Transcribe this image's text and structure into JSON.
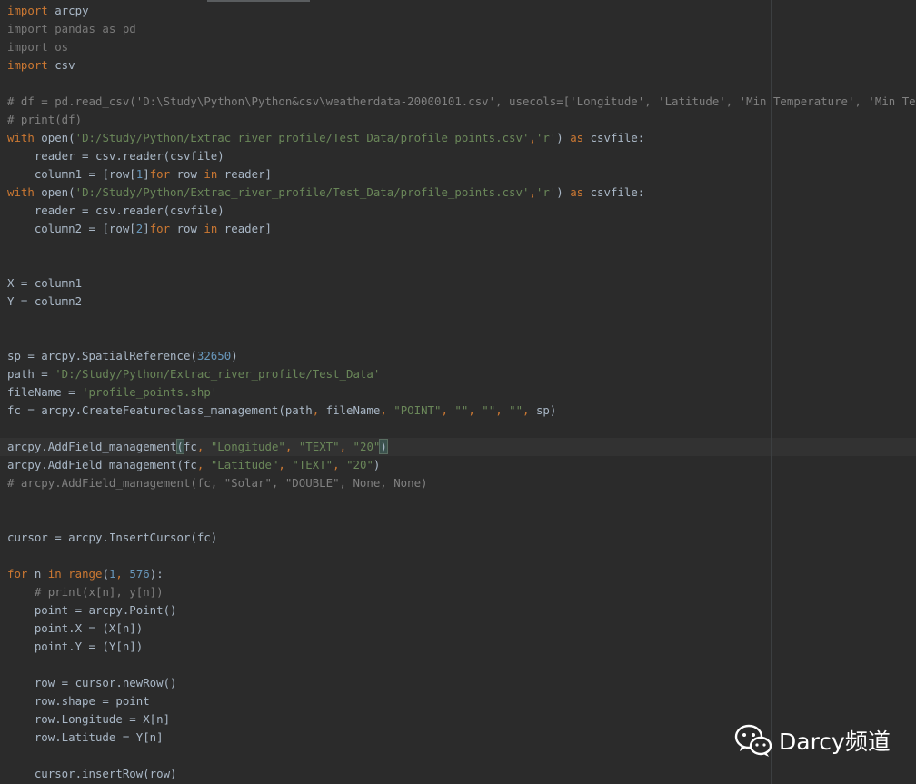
{
  "editor": {
    "lines": [
      [
        {
          "t": "import",
          "c": "kw"
        },
        {
          "t": " arcpy"
        }
      ],
      [
        {
          "t": "import pandas as pd",
          "c": "inactive"
        }
      ],
      [
        {
          "t": "import os",
          "c": "inactive"
        }
      ],
      [
        {
          "t": "import",
          "c": "kw"
        },
        {
          "t": " csv"
        }
      ],
      [],
      [
        {
          "t": "# df = pd.read_csv('D:\\Study\\Python\\Python&csv\\weatherdata-20000101.csv', usecols=['Longitude', 'Latitude', 'Min Temperature', 'Min Temperature']",
          "c": "cmt"
        }
      ],
      [
        {
          "t": "# print(df)",
          "c": "cmt"
        }
      ],
      [
        {
          "t": "with",
          "c": "kw"
        },
        {
          "t": " open("
        },
        {
          "t": "'D:/Study/Python/Extrac_river_profile/Test_Data/profile_points.csv'",
          "c": "str"
        },
        {
          "t": ",",
          "c": "kw"
        },
        {
          "t": "'r'",
          "c": "str"
        },
        {
          "t": ") "
        },
        {
          "t": "as",
          "c": "kw"
        },
        {
          "t": " csvfile:"
        }
      ],
      [
        {
          "t": "    reader = csv.reader(csvfile)"
        }
      ],
      [
        {
          "t": "    column1 = [row["
        },
        {
          "t": "1",
          "c": "num"
        },
        {
          "t": "]"
        },
        {
          "t": "for",
          "c": "kw"
        },
        {
          "t": " row "
        },
        {
          "t": "in",
          "c": "kw"
        },
        {
          "t": " reader]"
        }
      ],
      [
        {
          "t": "with",
          "c": "kw"
        },
        {
          "t": " open("
        },
        {
          "t": "'D:/Study/Python/Extrac_river_profile/Test_Data/profile_points.csv'",
          "c": "str"
        },
        {
          "t": ",",
          "c": "kw"
        },
        {
          "t": "'r'",
          "c": "str"
        },
        {
          "t": ") "
        },
        {
          "t": "as",
          "c": "kw"
        },
        {
          "t": " csvfile:"
        }
      ],
      [
        {
          "t": "    reader = csv.reader(csvfile)"
        }
      ],
      [
        {
          "t": "    column2 = [row["
        },
        {
          "t": "2",
          "c": "num"
        },
        {
          "t": "]"
        },
        {
          "t": "for",
          "c": "kw"
        },
        {
          "t": " row "
        },
        {
          "t": "in",
          "c": "kw"
        },
        {
          "t": " reader]"
        }
      ],
      [],
      [],
      [
        {
          "t": "X = column1"
        }
      ],
      [
        {
          "t": "Y = column2"
        }
      ],
      [],
      [],
      [
        {
          "t": "sp = arcpy.SpatialReference("
        },
        {
          "t": "32650",
          "c": "num"
        },
        {
          "t": ")"
        }
      ],
      [
        {
          "t": "path = "
        },
        {
          "t": "'D:/Study/Python/Extrac_river_profile/Test_Data'",
          "c": "str"
        }
      ],
      [
        {
          "t": "fileName = "
        },
        {
          "t": "'profile_points.shp'",
          "c": "str"
        }
      ],
      [
        {
          "t": "fc = arcpy.CreateFeatureclass_management(path"
        },
        {
          "t": ",",
          "c": "kw"
        },
        {
          "t": " fileName"
        },
        {
          "t": ",",
          "c": "kw"
        },
        {
          "t": " "
        },
        {
          "t": "\"POINT\"",
          "c": "str"
        },
        {
          "t": ",",
          "c": "kw"
        },
        {
          "t": " "
        },
        {
          "t": "\"\"",
          "c": "str"
        },
        {
          "t": ",",
          "c": "kw"
        },
        {
          "t": " "
        },
        {
          "t": "\"\"",
          "c": "str"
        },
        {
          "t": ",",
          "c": "kw"
        },
        {
          "t": " "
        },
        {
          "t": "\"\"",
          "c": "str"
        },
        {
          "t": ",",
          "c": "kw"
        },
        {
          "t": " sp)"
        }
      ],
      [],
      [
        {
          "t": "arcpy.AddField_management"
        },
        {
          "t": "(",
          "c": "bm"
        },
        {
          "t": "fc"
        },
        {
          "t": ",",
          "c": "kw"
        },
        {
          "t": " "
        },
        {
          "t": "\"Longitude\"",
          "c": "str"
        },
        {
          "t": ",",
          "c": "kw"
        },
        {
          "t": " "
        },
        {
          "t": "\"TEXT\"",
          "c": "str"
        },
        {
          "t": ",",
          "c": "kw"
        },
        {
          "t": " "
        },
        {
          "t": "\"20\"",
          "c": "str"
        },
        {
          "t": ")",
          "c": "bm"
        }
      ],
      [
        {
          "t": "arcpy.AddField_management(fc"
        },
        {
          "t": ",",
          "c": "kw"
        },
        {
          "t": " "
        },
        {
          "t": "\"Latitude\"",
          "c": "str"
        },
        {
          "t": ",",
          "c": "kw"
        },
        {
          "t": " "
        },
        {
          "t": "\"TEXT\"",
          "c": "str"
        },
        {
          "t": ",",
          "c": "kw"
        },
        {
          "t": " "
        },
        {
          "t": "\"20\"",
          "c": "str"
        },
        {
          "t": ")"
        }
      ],
      [
        {
          "t": "# arcpy.AddField_management(fc, \"Solar\", \"DOUBLE\", None, None)",
          "c": "cmt"
        }
      ],
      [],
      [],
      [
        {
          "t": "cursor = arcpy.InsertCursor(fc)"
        }
      ],
      [],
      [
        {
          "t": "for",
          "c": "kw"
        },
        {
          "t": " n "
        },
        {
          "t": "in",
          "c": "kw"
        },
        {
          "t": " "
        },
        {
          "t": "range",
          "c": "kw"
        },
        {
          "t": "("
        },
        {
          "t": "1",
          "c": "num"
        },
        {
          "t": ",",
          "c": "kw"
        },
        {
          "t": " "
        },
        {
          "t": "576",
          "c": "num"
        },
        {
          "t": "):"
        }
      ],
      [
        {
          "t": "    "
        },
        {
          "t": "# print(x[n], y[n])",
          "c": "cmt"
        }
      ],
      [
        {
          "t": "    point = arcpy.Point()"
        }
      ],
      [
        {
          "t": "    point.X = (X[n])"
        }
      ],
      [
        {
          "t": "    point.Y = (Y[n])"
        }
      ],
      [],
      [
        {
          "t": "    row = cursor.newRow()"
        }
      ],
      [
        {
          "t": "    row.shape = point"
        }
      ],
      [
        {
          "t": "    row.Longitude = X[n]"
        }
      ],
      [
        {
          "t": "    row.Latitude = Y[n]"
        }
      ],
      [],
      [
        {
          "t": "    cursor.insertRow(row)"
        }
      ]
    ]
  },
  "watermark": {
    "text": "Darcy频道",
    "icon": "wechat-icon"
  },
  "colors": {
    "background": "#2b2b2b",
    "text": "#a9b7c6",
    "keyword": "#cc7832",
    "string": "#6a8759",
    "number": "#6897bb",
    "comment": "#808080"
  }
}
